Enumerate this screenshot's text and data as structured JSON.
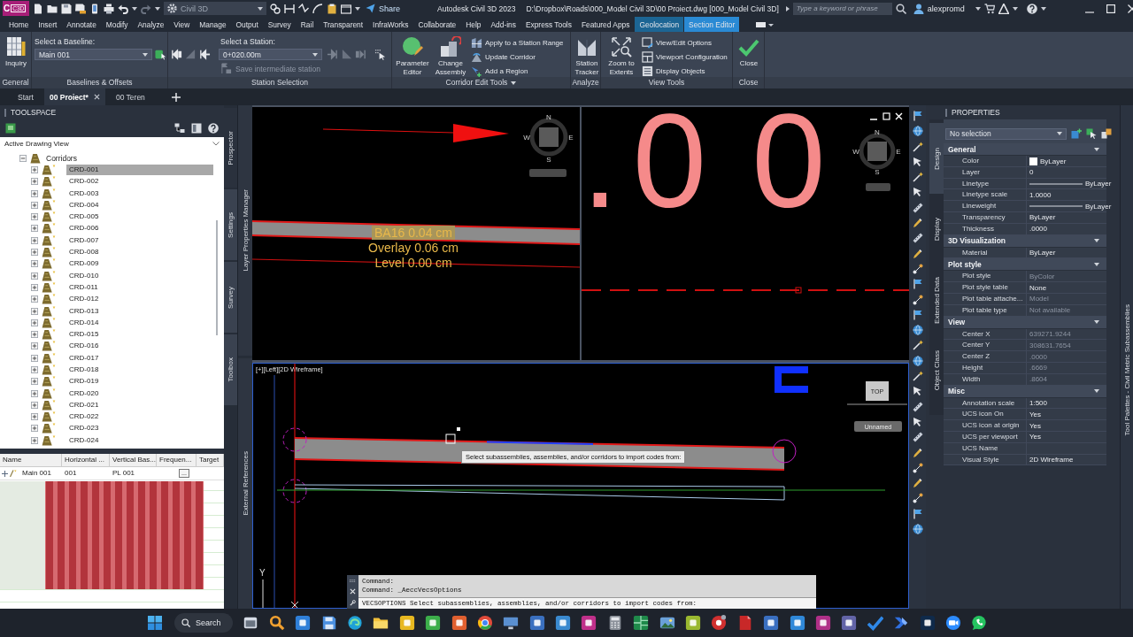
{
  "title_bar": {
    "app_logo": "C",
    "app_logo_tag": "C3D",
    "workspace": "Civil 3D",
    "share": "Share",
    "app_title": "Autodesk Civil 3D 2023",
    "file_path": "D:\\Dropbox\\Roads\\000_Model Civil 3D\\00 Proiect.dwg [000_Model Civil 3D]",
    "search": {
      "placeholder": "Type a keyword or phrase"
    },
    "user": "alexpromd"
  },
  "ribbon_tabs": [
    {
      "label": "Home",
      "kind": "standard",
      "selected": false
    },
    {
      "label": "Insert",
      "kind": "standard",
      "selected": false
    },
    {
      "label": "Annotate",
      "kind": "standard",
      "selected": false
    },
    {
      "label": "Modify",
      "kind": "standard",
      "selected": false
    },
    {
      "label": "Analyze",
      "kind": "standard",
      "selected": false
    },
    {
      "label": "View",
      "kind": "standard",
      "selected": false
    },
    {
      "label": "Manage",
      "kind": "standard",
      "selected": false
    },
    {
      "label": "Output",
      "kind": "standard",
      "selected": false
    },
    {
      "label": "Survey",
      "kind": "standard",
      "selected": false
    },
    {
      "label": "Rail",
      "kind": "standard",
      "selected": false
    },
    {
      "label": "Transparent",
      "kind": "standard",
      "selected": false
    },
    {
      "label": "InfraWorks",
      "kind": "standard",
      "selected": false
    },
    {
      "label": "Collaborate",
      "kind": "standard",
      "selected": false
    },
    {
      "label": "Help",
      "kind": "standard",
      "selected": false
    },
    {
      "label": "Add-ins",
      "kind": "standard",
      "selected": false
    },
    {
      "label": "Express Tools",
      "kind": "standard",
      "selected": false
    },
    {
      "label": "Featured Apps",
      "kind": "standard",
      "selected": false
    },
    {
      "label": "Geolocation",
      "kind": "contextual",
      "selected": false
    },
    {
      "label": "Section Editor",
      "kind": "contextual",
      "selected": true
    }
  ],
  "ribbon": {
    "general": {
      "title": "General",
      "inquiry": "Inquiry"
    },
    "baselines": {
      "title": "Baselines & Offsets",
      "label": "Select a Baseline:",
      "value": "Main 001"
    },
    "stations": {
      "title": "Station Selection",
      "label": "Select a Station:",
      "value": "0+020.00m",
      "save": {
        "label": "Save intermediate station",
        "disabled": true
      }
    },
    "corridor_tools": {
      "title": "Corridor Edit Tools",
      "large_buttons": [
        "Parameter Editor",
        "Change Assembly"
      ],
      "small_buttons": [
        "Apply to a Station Range",
        "Update Corridor",
        "Add a Region"
      ]
    },
    "analyze": {
      "title": "Analyze",
      "button": "Station Tracker"
    },
    "view_tools": {
      "title": "View Tools",
      "large_button": "Zoom to Extents",
      "small_buttons": [
        "View/Edit Options",
        "Viewport Configuration",
        "Display Objects"
      ]
    },
    "close": {
      "title": "Close",
      "button": "Close"
    }
  },
  "file_tabs": [
    {
      "label": "Start",
      "selected": false
    },
    {
      "label": "00 Proiect*",
      "selected": true
    },
    {
      "label": "00 Teren",
      "selected": false
    }
  ],
  "toolspace": {
    "title": "TOOLSPACE",
    "view": "Active Drawing View",
    "tree": [
      {
        "label": "Corridors",
        "expanded": true,
        "selected": false,
        "children": [
          {
            "label": "CRD-001",
            "expanded": false,
            "selected": true
          },
          {
            "label": "CRD-002",
            "expanded": false,
            "selected": false
          },
          {
            "label": "CRD-003",
            "expanded": false,
            "selected": false
          },
          {
            "label": "CRD-004",
            "expanded": false,
            "selected": false
          },
          {
            "label": "CRD-005",
            "expanded": false,
            "selected": false
          },
          {
            "label": "CRD-006",
            "expanded": false,
            "selected": false
          },
          {
            "label": "CRD-007",
            "expanded": false,
            "selected": false
          },
          {
            "label": "CRD-008",
            "expanded": false,
            "selected": false
          },
          {
            "label": "CRD-009",
            "expanded": false,
            "selected": false
          },
          {
            "label": "CRD-010",
            "expanded": false,
            "selected": false
          },
          {
            "label": "CRD-011",
            "expanded": false,
            "selected": false
          },
          {
            "label": "CRD-012",
            "expanded": false,
            "selected": false
          },
          {
            "label": "CRD-013",
            "expanded": false,
            "selected": false
          },
          {
            "label": "CRD-014",
            "expanded": false,
            "selected": false
          },
          {
            "label": "CRD-015",
            "expanded": false,
            "selected": false
          },
          {
            "label": "CRD-016",
            "expanded": false,
            "selected": false
          },
          {
            "label": "CRD-017",
            "expanded": false,
            "selected": false
          },
          {
            "label": "CRD-018",
            "expanded": false,
            "selected": false
          },
          {
            "label": "CRD-019",
            "expanded": false,
            "selected": false
          },
          {
            "label": "CRD-020",
            "expanded": false,
            "selected": false
          },
          {
            "label": "CRD-021",
            "expanded": false,
            "selected": false
          },
          {
            "label": "CRD-022",
            "expanded": false,
            "selected": false
          },
          {
            "label": "CRD-023",
            "expanded": false,
            "selected": false
          },
          {
            "label": "CRD-024",
            "expanded": false,
            "selected": false
          }
        ]
      }
    ],
    "tabs": [
      {
        "label": "Prospector",
        "selected": true
      },
      {
        "label": "Settings",
        "selected": false
      },
      {
        "label": "Survey",
        "selected": false
      },
      {
        "label": "Toolbox",
        "selected": false
      }
    ]
  },
  "baseline_table": {
    "columns": [
      "Name",
      "Horizontal ...",
      "Vertical Bas...",
      "Frequen...",
      "Target"
    ],
    "rows": [
      {
        "name": "Main 001",
        "horizontal": "001",
        "vertical": "PL 001",
        "frequency": "..."
      }
    ]
  },
  "side_tabs": [
    "Layer Properties Manager",
    "External References"
  ],
  "viewports": {
    "top_left": {
      "labels": [
        {
          "text": "BA16 0.04 cm",
          "highlighted": true
        },
        {
          "text": "Overlay 0.06 cm",
          "highlighted": false
        },
        {
          "text": "Level 0.00 cm",
          "highlighted": false
        }
      ],
      "compass": {
        "n": "N",
        "e": "E",
        "s": "S",
        "w": "W"
      }
    },
    "top_right": {
      "big_text": ".00",
      "compass": {
        "n": "N",
        "e": "E",
        "s": "S",
        "w": "W"
      }
    },
    "bottom": {
      "label": "[+][Left][2D Wireframe]",
      "view_cube": "TOP",
      "view_name": "Unnamed",
      "tooltip": "Select subassemblies, assemblies, and/or corridors to import codes from:",
      "ucs_axis": "Y"
    }
  },
  "command_line": {
    "history": [
      "Command:",
      "Command: _AeccVecsOptions"
    ],
    "prompt": "VECSOPTIONS Select subassemblies, assemblies, and/or corridors to import codes from:"
  },
  "properties": {
    "title": "PROPERTIES",
    "selection": "No selection",
    "tabs": [
      {
        "label": "Design",
        "selected": true
      },
      {
        "label": "Display",
        "selected": false
      },
      {
        "label": "Extended Data",
        "selected": false
      },
      {
        "label": "Object Class",
        "selected": false
      }
    ],
    "sections": [
      {
        "title": "General",
        "expanded": true,
        "rows": [
          {
            "label": "Color",
            "value": "ByLayer",
            "kind": "color",
            "disabled": false
          },
          {
            "label": "Layer",
            "value": "0",
            "kind": "text",
            "disabled": false
          },
          {
            "label": "Linetype",
            "value": "ByLayer",
            "kind": "linetype",
            "disabled": false
          },
          {
            "label": "Linetype scale",
            "value": "1.0000",
            "kind": "text",
            "disabled": false
          },
          {
            "label": "Lineweight",
            "value": "ByLayer",
            "kind": "linetype",
            "disabled": false
          },
          {
            "label": "Transparency",
            "value": "ByLayer",
            "kind": "text",
            "disabled": false
          },
          {
            "label": "Thickness",
            "value": ".0000",
            "kind": "text",
            "disabled": false
          }
        ]
      },
      {
        "title": "3D Visualization",
        "expanded": true,
        "rows": [
          {
            "label": "Material",
            "value": "ByLayer",
            "kind": "text",
            "disabled": false
          }
        ]
      },
      {
        "title": "Plot style",
        "expanded": true,
        "rows": [
          {
            "label": "Plot style",
            "value": "ByColor",
            "kind": "text",
            "disabled": true
          },
          {
            "label": "Plot style table",
            "value": "None",
            "kind": "text",
            "disabled": false
          },
          {
            "label": "Plot table attache...",
            "value": "Model",
            "kind": "text",
            "disabled": true
          },
          {
            "label": "Plot table type",
            "value": "Not available",
            "kind": "text",
            "disabled": true
          }
        ]
      },
      {
        "title": "View",
        "expanded": true,
        "rows": [
          {
            "label": "Center X",
            "value": "639271.9244",
            "kind": "text",
            "disabled": true
          },
          {
            "label": "Center Y",
            "value": "308631.7654",
            "kind": "text",
            "disabled": true
          },
          {
            "label": "Center Z",
            "value": ".0000",
            "kind": "text",
            "disabled": true
          },
          {
            "label": "Height",
            "value": ".6669",
            "kind": "text",
            "disabled": true
          },
          {
            "label": "Width",
            "value": ".8604",
            "kind": "text",
            "disabled": true
          }
        ]
      },
      {
        "title": "Misc",
        "expanded": true,
        "rows": [
          {
            "label": "Annotation scale",
            "value": "1:500",
            "kind": "text",
            "disabled": false
          },
          {
            "label": "UCS icon On",
            "value": "Yes",
            "kind": "text",
            "disabled": false
          },
          {
            "label": "UCS icon at origin",
            "value": "Yes",
            "kind": "text",
            "disabled": false
          },
          {
            "label": "UCS per viewport",
            "value": "Yes",
            "kind": "text",
            "disabled": false
          },
          {
            "label": "UCS Name",
            "kind": "text"
          },
          {
            "label": "Visual Style",
            "value": "2D Wireframe",
            "kind": "text",
            "disabled": false
          }
        ]
      }
    ]
  },
  "tool_palettes": "Tool Palettes - Civil Metric Subassemblies",
  "taskbar": {
    "search": "Search"
  }
}
